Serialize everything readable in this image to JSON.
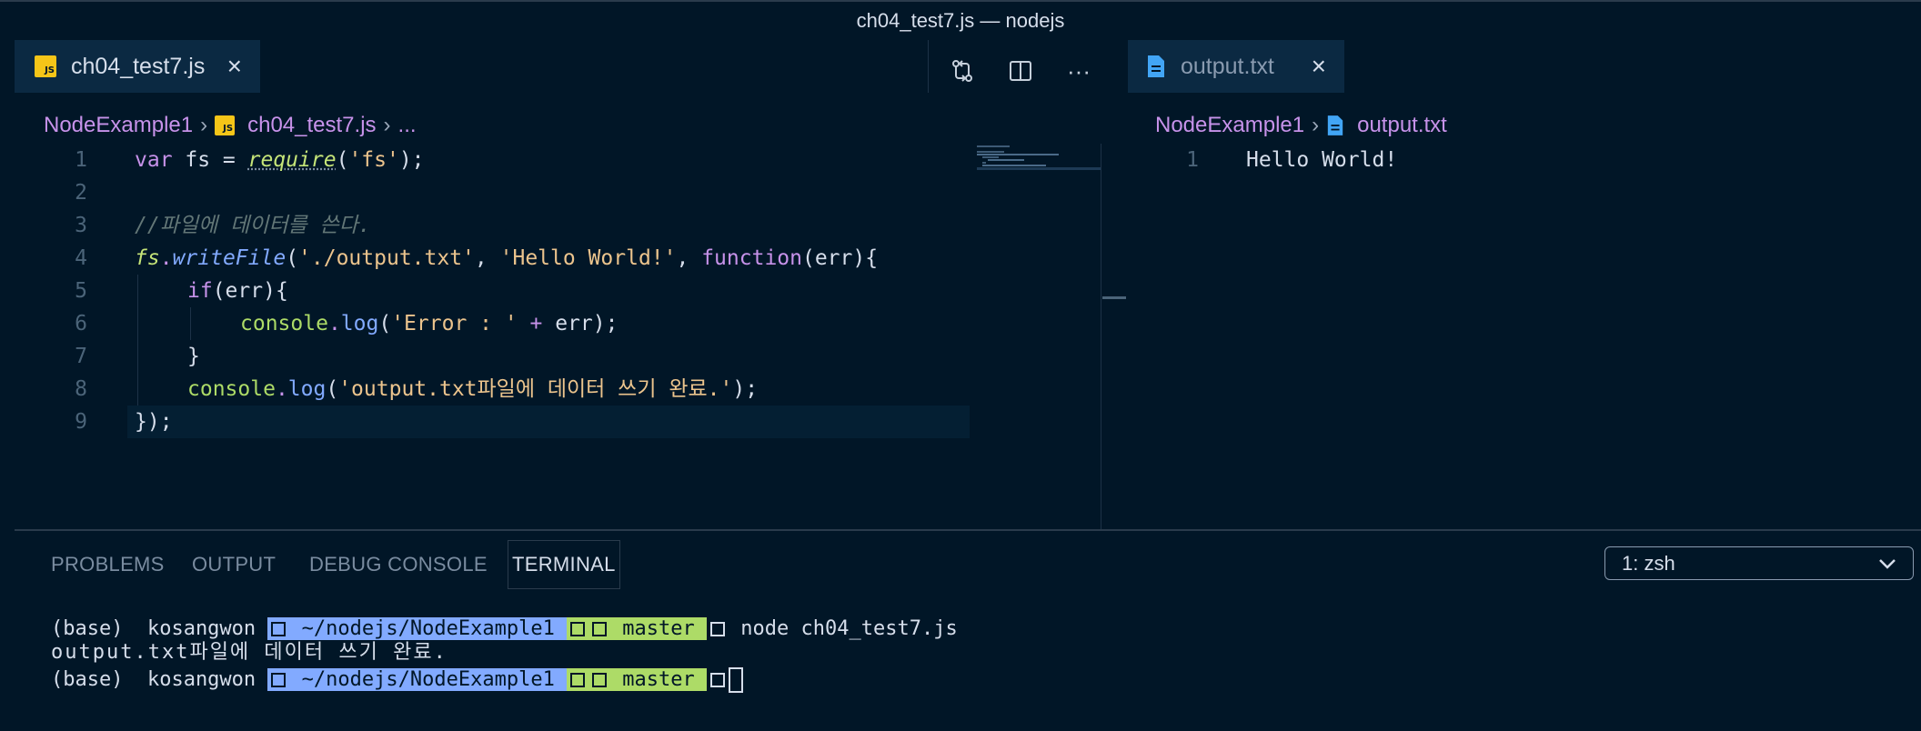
{
  "window": {
    "title": "ch04_test7.js — nodejs"
  },
  "left_editor": {
    "tab_label": "ch04_test7.js",
    "tab_icon": "JS",
    "breadcrumb": [
      "NodeExample1",
      "ch04_test7.js",
      "..."
    ],
    "line_numbers": [
      "1",
      "2",
      "3",
      "4",
      "5",
      "6",
      "7",
      "8",
      "9"
    ]
  },
  "right_editor": {
    "tab_label": "output.txt",
    "breadcrumb": [
      "NodeExample1",
      "output.txt"
    ],
    "line_number": "1",
    "content": "Hello World!"
  },
  "code": {
    "l1": {
      "kw": "var",
      "name": " fs = ",
      "fn": "require",
      "p1": "(",
      "str": "'fs'",
      "p2": ");"
    },
    "l3": {
      "comment": "//파일에 데이터를 쓴다."
    },
    "l4": {
      "obj": "fs",
      "dot": ".",
      "fn": "writeFile",
      "p1": "(",
      "s1": "'./output.txt'",
      "c1": ", ",
      "s2": "'Hello World!'",
      "c2": ", ",
      "kw": "function",
      "rest": "(err){"
    },
    "l5": {
      "kw": "if",
      "rest": "(err){"
    },
    "l6": {
      "obj": "console",
      "dot": ".",
      "fn": "log",
      "p1": "(",
      "str": "'Error : '",
      "op": " + ",
      "rest": "err);"
    },
    "l7": {
      "rest": "}"
    },
    "l8": {
      "obj": "console",
      "dot": ".",
      "fn": "log",
      "p1": "(",
      "str": "'output.txt파일에 데이터 쓰기 완료.'",
      "rest": ");"
    },
    "l9": {
      "rest": "});"
    }
  },
  "panel": {
    "tabs": [
      "PROBLEMS",
      "OUTPUT",
      "DEBUG CONSOLE",
      "TERMINAL"
    ],
    "active_tab": "TERMINAL",
    "shell_select": "1: zsh"
  },
  "terminal": {
    "line1": {
      "prefix": "(base)  kosangwon ",
      "path": " ~/nodejs/NodeExample1 ",
      "branch": " master ",
      "cmd": " node ch04_test7.js"
    },
    "line2": "output.txt파일에 데이터 쓰기 완료.",
    "line3": {
      "prefix": "(base)  kosangwon ",
      "path": " ~/nodejs/NodeExample1 ",
      "branch": " master "
    }
  }
}
